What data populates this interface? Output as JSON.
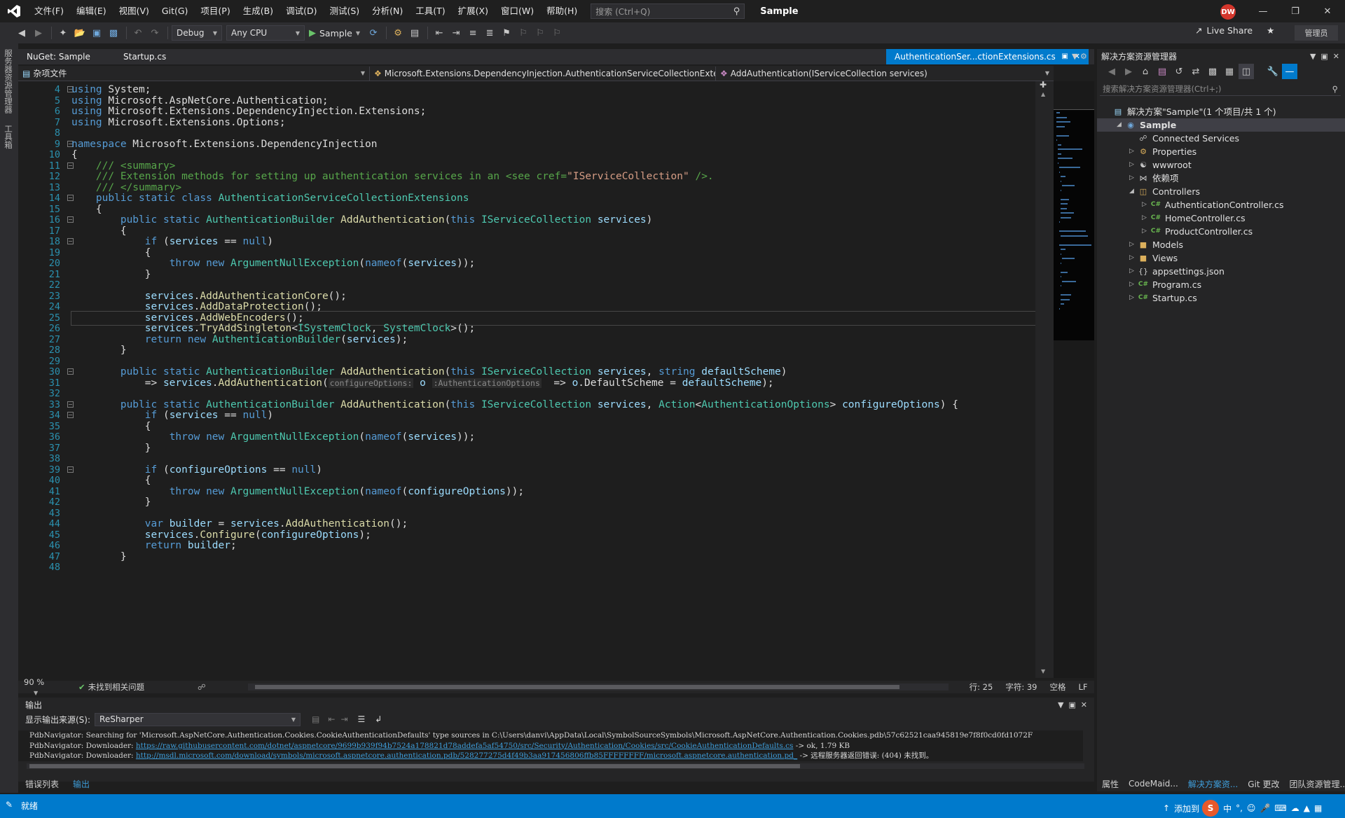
{
  "titlebar": {
    "menu": [
      "文件(F)",
      "编辑(E)",
      "视图(V)",
      "Git(G)",
      "项目(P)",
      "生成(B)",
      "调试(D)",
      "测试(S)",
      "分析(N)",
      "工具(T)",
      "扩展(X)",
      "窗口(W)",
      "帮助(H)"
    ],
    "search_placeholder": "搜索 (Ctrl+Q)",
    "solution_name": "Sample",
    "avatar_initials": "DW"
  },
  "toolbar": {
    "configuration": "Debug",
    "platform": "Any CPU",
    "run_target": "Sample",
    "live_share": "Live Share",
    "admin_label": "管理员"
  },
  "left_strip": {
    "tabs": [
      "服务器资源管理器",
      "工具箱"
    ]
  },
  "tabs": {
    "items": [
      "NuGet: Sample",
      "Startup.cs"
    ],
    "active": "AuthenticationSer...ctionExtensions.cs"
  },
  "navbar": {
    "project": "杂项文件",
    "type": "Microsoft.Extensions.DependencyInjection.AuthenticationServiceCollectionExte",
    "member": "AddAuthentication(IServiceCollection services)"
  },
  "editor": {
    "first_line": 4,
    "current_line": 25,
    "fold_lines": [
      4,
      9,
      11,
      14,
      16,
      18,
      30,
      33,
      34,
      39
    ],
    "lines": [
      "using System;",
      "using Microsoft.AspNetCore.Authentication;",
      "using Microsoft.Extensions.DependencyInjection.Extensions;",
      "using Microsoft.Extensions.Options;",
      "",
      "namespace Microsoft.Extensions.DependencyInjection",
      "{",
      "    /// <summary>",
      "    /// Extension methods for setting up authentication services in an <see cref=\"IServiceCollection\" />.",
      "    /// </summary>",
      "    public static class AuthenticationServiceCollectionExtensions",
      "    {",
      "        public static AuthenticationBuilder AddAuthentication(this IServiceCollection services)",
      "        {",
      "            if (services == null)",
      "            {",
      "                throw new ArgumentNullException(nameof(services));",
      "            }",
      "",
      "            services.AddAuthenticationCore();",
      "            services.AddDataProtection();",
      "            services.AddWebEncoders();",
      "            services.TryAddSingleton<ISystemClock, SystemClock>();",
      "            return new AuthenticationBuilder(services);",
      "        }",
      "",
      "        public static AuthenticationBuilder AddAuthentication(this IServiceCollection services, string defaultScheme)",
      "            => services.AddAuthentication(configureOptions: o :AuthenticationOptions  => o.DefaultScheme = defaultScheme);",
      "",
      "        public static AuthenticationBuilder AddAuthentication(this IServiceCollection services, Action<AuthenticationOptions> configureOptions) {",
      "            if (services == null)",
      "            {",
      "                throw new ArgumentNullException(nameof(services));",
      "            }",
      "",
      "            if (configureOptions == null)",
      "            {",
      "                throw new ArgumentNullException(nameof(configureOptions));",
      "            }",
      "",
      "            var builder = services.AddAuthentication();",
      "            services.Configure(configureOptions);",
      "            return builder;",
      "        }",
      ""
    ]
  },
  "editor_status": {
    "zoom": "90 %",
    "issues": "未找到相关问题",
    "line": "行: 25",
    "char": "字符: 39",
    "whitespace": "空格",
    "eol": "LF"
  },
  "output": {
    "title": "输出",
    "source_label": "显示输出来源(S):",
    "source_value": "ReSharper",
    "lines": [
      {
        "text": "PdbNavigator: Searching for 'Microsoft.AspNetCore.Authentication.Cookies.CookieAuthenticationDefaults' type sources in C:\\Users\\danvi\\AppData\\Local\\SymbolSourceSymbols\\Microsoft.AspNetCore.Authentication.Cookies.pdb\\57c62521caa945819e7f8f0cd0fd1072F",
        "link": "",
        "tail": ""
      },
      {
        "text": "PdbNavigator: Downloader: ",
        "link": "https://raw.githubusercontent.com/dotnet/aspnetcore/9699b939f94b7524a178821d78addefa5af54750/src/Security/Authentication/Cookies/src/CookieAuthenticationDefaults.cs",
        "tail": " -> ok, 1.79 KB"
      },
      {
        "text": "PdbNavigator: Downloader: ",
        "link": "http://msdl.microsoft.com/download/symbols/microsoft.aspnetcore.authentication.pdb/528277275d4f49b3aa917456806ffb85FFFFFFFF/microsoft.aspnetcore.authentication.pd_",
        "tail": " -> 远程服务器返回错误: (404) 未找到。"
      }
    ]
  },
  "bottom_tabs": [
    "错误列表",
    "输出"
  ],
  "solution_explorer": {
    "title": "解决方案资源管理器",
    "search_placeholder": "搜索解决方案资源管理器(Ctrl+;)",
    "items": [
      {
        "label": "解决方案\"Sample\"(1 个项目/共 1 个)",
        "icon": "solution-icon",
        "depth": 0,
        "expander": ""
      },
      {
        "label": "Sample",
        "icon": "project-icon",
        "depth": 1,
        "expander": "down"
      },
      {
        "label": "Connected Services",
        "icon": "connected-services-icon",
        "depth": 2,
        "expander": ""
      },
      {
        "label": "Properties",
        "icon": "gear-icon",
        "depth": 2,
        "expander": "right"
      },
      {
        "label": "wwwroot",
        "icon": "globe-icon",
        "depth": 2,
        "expander": "right"
      },
      {
        "label": "依赖项",
        "icon": "dependencies-icon",
        "depth": 2,
        "expander": "right"
      },
      {
        "label": "Controllers",
        "icon": "folder-open-icon",
        "depth": 2,
        "expander": "down"
      },
      {
        "label": "AuthenticationController.cs",
        "icon": "csharp-file-icon",
        "depth": 3,
        "expander": "right"
      },
      {
        "label": "HomeController.cs",
        "icon": "csharp-file-icon",
        "depth": 3,
        "expander": "right"
      },
      {
        "label": "ProductController.cs",
        "icon": "csharp-file-icon",
        "depth": 3,
        "expander": "right"
      },
      {
        "label": "Models",
        "icon": "folder-icon",
        "depth": 2,
        "expander": "right"
      },
      {
        "label": "Views",
        "icon": "folder-icon",
        "depth": 2,
        "expander": "right"
      },
      {
        "label": "appsettings.json",
        "icon": "json-file-icon",
        "depth": 2,
        "expander": "right"
      },
      {
        "label": "Program.cs",
        "icon": "csharp-file-icon",
        "depth": 2,
        "expander": "right"
      },
      {
        "label": "Startup.cs",
        "icon": "csharp-file-icon",
        "depth": 2,
        "expander": "right"
      }
    ],
    "bottom_tabs": [
      "属性",
      "CodeMaid...",
      "解决方案资...",
      "Git 更改",
      "团队资源管理..."
    ]
  },
  "statusbar": {
    "state": "就绪",
    "right": "添加到"
  }
}
